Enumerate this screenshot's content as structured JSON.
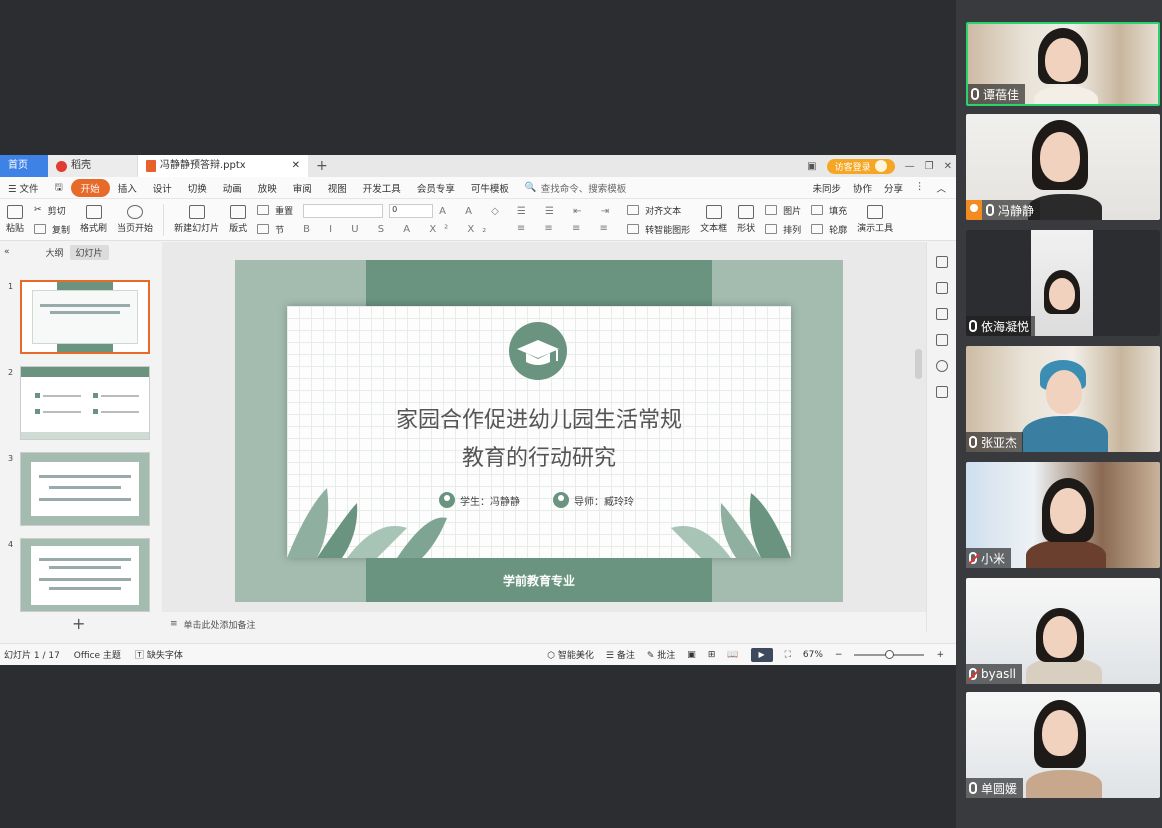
{
  "app": {
    "tabs": {
      "home": "首页",
      "shell": "稻壳",
      "document": "冯静静预答辩.pptx"
    },
    "login": "访客登录",
    "menu": [
      "文件",
      "开始",
      "插入",
      "设计",
      "切换",
      "动画",
      "放映",
      "审阅",
      "视图",
      "开发工具",
      "会员专享",
      "可牛模板"
    ],
    "menu_active": "开始",
    "search_placeholder": "查找命令、搜索模板",
    "menu_right": [
      "未同步",
      "协作",
      "分享"
    ],
    "ribbon": {
      "paste": "粘贴",
      "cut": "剪切",
      "copy": "复制",
      "format_painter": "格式刷",
      "start_from_current": "当页开始",
      "new_slide": "新建幻灯片",
      "layout": "版式",
      "reset": "重置",
      "section": "节",
      "font_size": "0",
      "align_text": "对齐文本",
      "smartart": "转智能图形",
      "textbox": "文本框",
      "shape": "形状",
      "arrange": "排列",
      "image": "图片",
      "fill": "填充",
      "outline": "轮廓",
      "present_tools": "演示工具"
    },
    "panel_tabs": {
      "outline": "大纲",
      "slides": "幻灯片"
    },
    "thumb_numbers": [
      "1",
      "2",
      "3",
      "4"
    ],
    "notes_placeholder": "单击此处添加备注",
    "status": {
      "slide_count": "幻灯片 1 / 17",
      "theme": "Office 主题",
      "missing_font": "缺失字体",
      "smart_beautify": "智能美化",
      "notes": "备注",
      "comments": "批注",
      "zoom": "67%"
    }
  },
  "slide": {
    "title_line1": "家园合作促进幼儿园生活常规",
    "title_line2": "教育的行动研究",
    "student": "学生：冯静静",
    "advisor": "导师：臧玲玲",
    "footer": "学前教育专业",
    "accent_color": "#6a9480"
  },
  "participants": [
    {
      "name": "谭蓓佳",
      "muted": false,
      "active": true
    },
    {
      "name": "冯静静",
      "muted": false,
      "active": false,
      "host": true
    },
    {
      "name": "依海凝悦",
      "muted": false,
      "active": false
    },
    {
      "name": "张亚杰",
      "muted": false,
      "active": false
    },
    {
      "name": "小米",
      "muted": true,
      "active": false
    },
    {
      "name": "byasll",
      "muted": true,
      "active": false
    },
    {
      "name": "单圆媛",
      "muted": false,
      "active": false
    }
  ]
}
